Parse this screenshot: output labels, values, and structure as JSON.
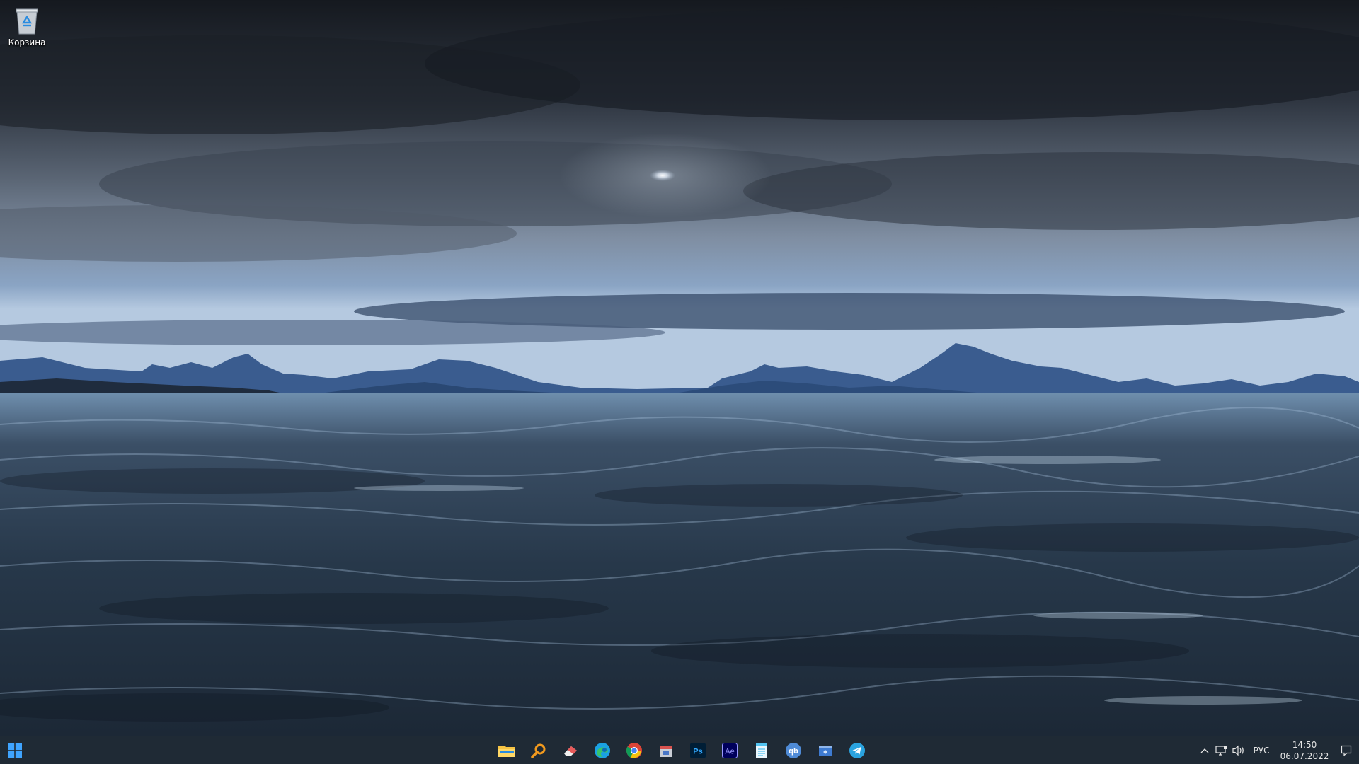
{
  "desktop": {
    "icons": [
      {
        "label": "Корзина",
        "icon": "recycle-bin-icon"
      }
    ]
  },
  "taskbar": {
    "start_icon": "windows-logo-icon",
    "pinned": [
      {
        "app": "File Explorer",
        "icon": "folder-icon",
        "color": "#f6c343"
      },
      {
        "app": "Search",
        "icon": "search-icon",
        "color": "#f29a1e"
      },
      {
        "app": "Eraser",
        "icon": "eraser-icon",
        "color": "#e85a5a"
      },
      {
        "app": "Microsoft Edge",
        "icon": "edge-icon",
        "color": "#1aa1e3"
      },
      {
        "app": "Google Chrome",
        "icon": "chrome-icon",
        "color": "#2fa84f"
      },
      {
        "app": "Package",
        "icon": "package-icon",
        "color": "#d9534f"
      },
      {
        "app": "Adobe Photoshop",
        "icon": "photoshop-icon",
        "label": "Ps",
        "color": "#31a8ff"
      },
      {
        "app": "Adobe After Effects",
        "icon": "after-effects-icon",
        "label": "Ae",
        "color": "#9999ff"
      },
      {
        "app": "Notepad",
        "icon": "notepad-icon",
        "color": "#52c3f1"
      },
      {
        "app": "qBittorrent",
        "icon": "qbittorrent-icon",
        "label": "qb",
        "color": "#4f8bd6"
      },
      {
        "app": "Window",
        "icon": "window-icon",
        "color": "#3e7bd1"
      },
      {
        "app": "Telegram",
        "icon": "telegram-icon",
        "color": "#2aa3df"
      }
    ],
    "tray": {
      "chevron_icon": "chevron-up-icon",
      "network_icon": "network-icon",
      "volume_icon": "speaker-icon",
      "language": "РУС",
      "time": "14:50",
      "date": "06.07.2022",
      "notification_icon": "notification-icon"
    }
  },
  "colors": {
    "taskbar_bg": "#1f2a35",
    "accent_windows": "#3fa4ff"
  }
}
